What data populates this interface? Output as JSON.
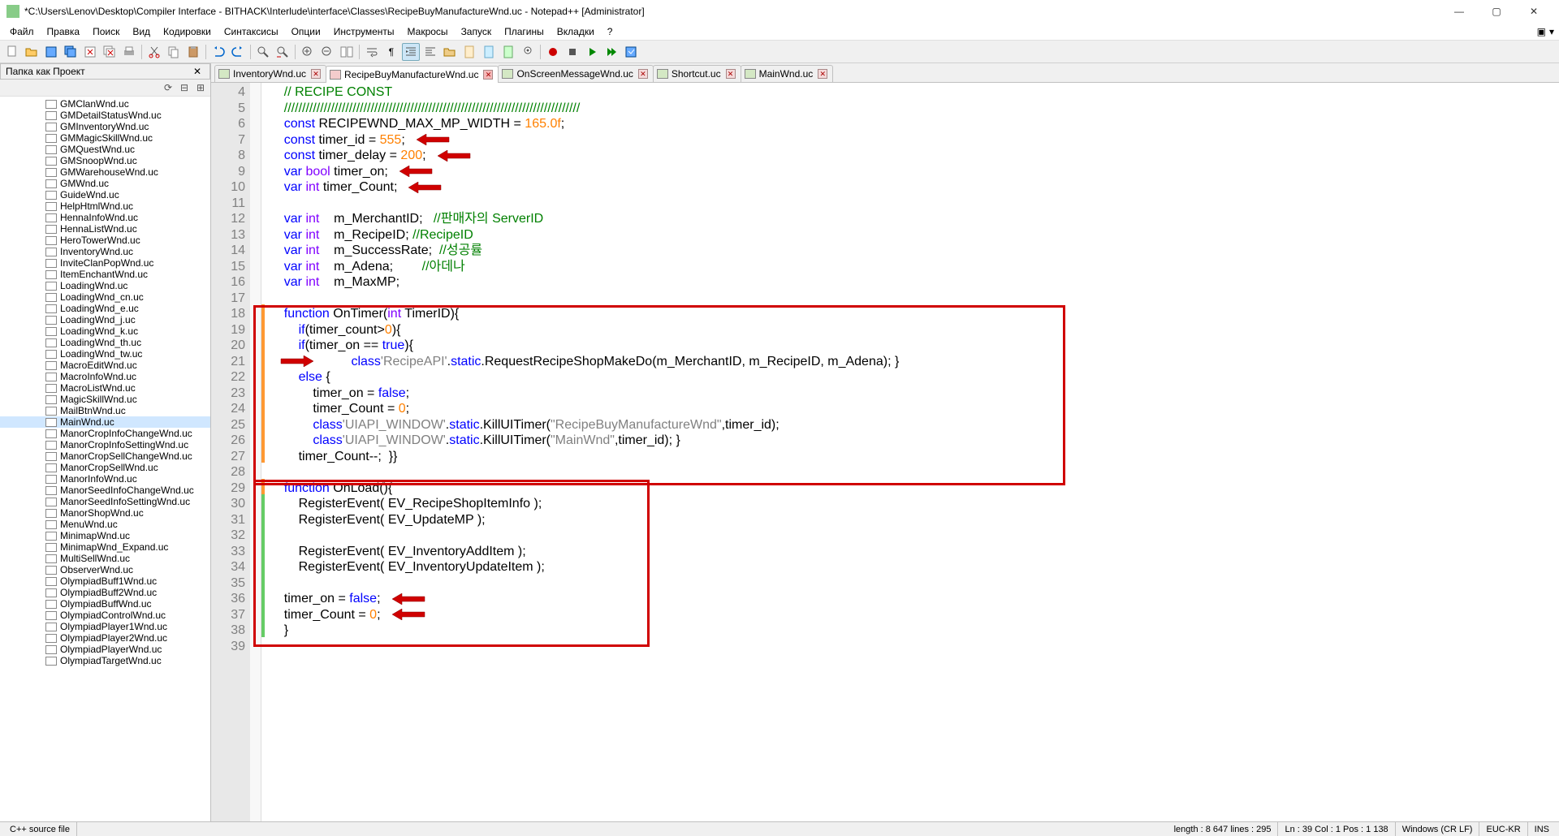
{
  "window": {
    "title": "*C:\\Users\\Lenov\\Desktop\\Compiler Interface - BITHACK\\Interlude\\interface\\Classes\\RecipeBuyManufactureWnd.uc - Notepad++ [Administrator]"
  },
  "menu": {
    "items": [
      "Файл",
      "Правка",
      "Поиск",
      "Вид",
      "Кодировки",
      "Синтаксисы",
      "Опции",
      "Инструменты",
      "Макросы",
      "Запуск",
      "Плагины",
      "Вкладки",
      "?"
    ]
  },
  "panel": {
    "title": "Папка как Проект"
  },
  "tree": {
    "items": [
      "GMClanWnd.uc",
      "GMDetailStatusWnd.uc",
      "GMInventoryWnd.uc",
      "GMMagicSkillWnd.uc",
      "GMQuestWnd.uc",
      "GMSnoopWnd.uc",
      "GMWarehouseWnd.uc",
      "GMWnd.uc",
      "GuideWnd.uc",
      "HelpHtmlWnd.uc",
      "HennaInfoWnd.uc",
      "HennaListWnd.uc",
      "HeroTowerWnd.uc",
      "InventoryWnd.uc",
      "InviteClanPopWnd.uc",
      "ItemEnchantWnd.uc",
      "LoadingWnd.uc",
      "LoadingWnd_cn.uc",
      "LoadingWnd_e.uc",
      "LoadingWnd_j.uc",
      "LoadingWnd_k.uc",
      "LoadingWnd_th.uc",
      "LoadingWnd_tw.uc",
      "MacroEditWnd.uc",
      "MacroInfoWnd.uc",
      "MacroListWnd.uc",
      "MagicSkillWnd.uc",
      "MailBtnWnd.uc",
      "MainWnd.uc",
      "ManorCropInfoChangeWnd.uc",
      "ManorCropInfoSettingWnd.uc",
      "ManorCropSellChangeWnd.uc",
      "ManorCropSellWnd.uc",
      "ManorInfoWnd.uc",
      "ManorSeedInfoChangeWnd.uc",
      "ManorSeedInfoSettingWnd.uc",
      "ManorShopWnd.uc",
      "MenuWnd.uc",
      "MinimapWnd.uc",
      "MinimapWnd_Expand.uc",
      "MultiSellWnd.uc",
      "ObserverWnd.uc",
      "OlympiadBuff1Wnd.uc",
      "OlympiadBuff2Wnd.uc",
      "OlympiadBuffWnd.uc",
      "OlympiadControlWnd.uc",
      "OlympiadPlayer1Wnd.uc",
      "OlympiadPlayer2Wnd.uc",
      "OlympiadPlayerWnd.uc",
      "OlympiadTargetWnd.uc"
    ],
    "selected": 28
  },
  "tabs": {
    "items": [
      {
        "label": "InventoryWnd.uc",
        "dirty": false
      },
      {
        "label": "RecipeBuyManufactureWnd.uc",
        "dirty": true
      },
      {
        "label": "OnScreenMessageWnd.uc",
        "dirty": false
      },
      {
        "label": "Shortcut.uc",
        "dirty": false
      },
      {
        "label": "MainWnd.uc",
        "dirty": false
      }
    ],
    "active": 1
  },
  "code": {
    "first_line": 4,
    "lines": [
      {
        "n": 4,
        "html": "<span class='c-comment'>// RECIPE CONST</span>"
      },
      {
        "n": 5,
        "html": "<span class='c-comment'>//////////////////////////////////////////////////////////////////////////////////</span>"
      },
      {
        "n": 6,
        "html": "<span class='c-keyword'>const</span> RECIPEWND_MAX_MP_WIDTH = <span class='c-number'>165.0f</span>;"
      },
      {
        "n": 7,
        "html": "<span class='c-keyword'>const</span> timer_id = <span class='c-number'>555</span>;",
        "arrow": true
      },
      {
        "n": 8,
        "html": "<span class='c-keyword'>const</span> timer_delay = <span class='c-number'>200</span>;",
        "arrow": true
      },
      {
        "n": 9,
        "html": "<span class='c-keyword'>var</span> <span class='c-type'>bool</span> timer_on;",
        "arrow": true
      },
      {
        "n": 10,
        "html": "<span class='c-keyword'>var</span> <span class='c-type'>int</span> timer_Count;",
        "arrow": true
      },
      {
        "n": 11,
        "html": ""
      },
      {
        "n": 12,
        "html": "<span class='c-keyword'>var</span> <span class='c-type'>int</span>    m_MerchantID;   <span class='c-comment'>//판매자의 ServerID</span>"
      },
      {
        "n": 13,
        "html": "<span class='c-keyword'>var</span> <span class='c-type'>int</span>    m_RecipeID; <span class='c-comment'>//RecipeID</span>"
      },
      {
        "n": 14,
        "html": "<span class='c-keyword'>var</span> <span class='c-type'>int</span>    m_SuccessRate;  <span class='c-comment'>//성공률</span>"
      },
      {
        "n": 15,
        "html": "<span class='c-keyword'>var</span> <span class='c-type'>int</span>    m_Adena;        <span class='c-comment'>//아데나</span>"
      },
      {
        "n": 16,
        "html": "<span class='c-keyword'>var</span> <span class='c-type'>int</span>    m_MaxMP;"
      },
      {
        "n": 17,
        "html": ""
      },
      {
        "n": 18,
        "html": "<span class='c-keyword'>function</span> OnTimer(<span class='c-type'>int</span> TimerID){",
        "cb": "orange"
      },
      {
        "n": 19,
        "html": "    <span class='c-keyword'>if</span>(timer_count&gt;<span class='c-number'>0</span>){",
        "cb": "orange"
      },
      {
        "n": 20,
        "html": "    <span class='c-keyword'>if</span>(timer_on == <span class='c-keyword'>true</span>){",
        "cb": "orange"
      },
      {
        "n": 21,
        "html": "        <span class='c-keyword'>class</span><span class='c-string'>'RecipeAPI'</span>.<span class='c-keyword'>static</span>.RequestRecipeShopMakeDo(m_MerchantID, m_RecipeID, m_Adena); }",
        "cb": "orange",
        "arrowLeft": true
      },
      {
        "n": 22,
        "html": "    <span class='c-keyword'>else</span> {",
        "cb": "orange"
      },
      {
        "n": 23,
        "html": "        timer_on = <span class='c-keyword'>false</span>;",
        "cb": "orange"
      },
      {
        "n": 24,
        "html": "        timer_Count = <span class='c-number'>0</span>;",
        "cb": "orange"
      },
      {
        "n": 25,
        "html": "        <span class='c-keyword'>class</span><span class='c-string'>'UIAPI_WINDOW'</span>.<span class='c-keyword'>static</span>.KillUITimer(<span class='c-string'>\"RecipeBuyManufactureWnd\"</span>,timer_id);",
        "cb": "orange"
      },
      {
        "n": 26,
        "html": "        <span class='c-keyword'>class</span><span class='c-string'>'UIAPI_WINDOW'</span>.<span class='c-keyword'>static</span>.KillUITimer(<span class='c-string'>\"MainWnd\"</span>,timer_id); }",
        "cb": "orange"
      },
      {
        "n": 27,
        "html": "    timer_Count--;  }}",
        "cb": "orange"
      },
      {
        "n": 28,
        "html": ""
      },
      {
        "n": 29,
        "html": "<span class='c-keyword'>function</span> OnLoad(){",
        "cb": "orange"
      },
      {
        "n": 30,
        "html": "    RegisterEvent( EV_RecipeShopItemInfo );",
        "cb": "green"
      },
      {
        "n": 31,
        "html": "    RegisterEvent( EV_UpdateMP );",
        "cb": "green"
      },
      {
        "n": 32,
        "html": "",
        "cb": "green"
      },
      {
        "n": 33,
        "html": "    RegisterEvent( EV_InventoryAddItem );",
        "cb": "green"
      },
      {
        "n": 34,
        "html": "    RegisterEvent( EV_InventoryUpdateItem );",
        "cb": "green"
      },
      {
        "n": 35,
        "html": "",
        "cb": "green"
      },
      {
        "n": 36,
        "html": "timer_on = <span class='c-keyword'>false</span>;",
        "cb": "green",
        "arrow": true
      },
      {
        "n": 37,
        "html": "timer_Count = <span class='c-number'>0</span>;",
        "cb": "green",
        "arrow": true
      },
      {
        "n": 38,
        "html": "}",
        "cb": "green"
      },
      {
        "n": 39,
        "html": ""
      }
    ]
  },
  "status": {
    "lang": "C++ source file",
    "length": "length : 8 647    lines : 295",
    "pos": "Ln : 39    Col : 1    Pos : 1 138",
    "eol": "Windows (CR LF)",
    "enc": "EUC-KR",
    "ins": "INS"
  }
}
